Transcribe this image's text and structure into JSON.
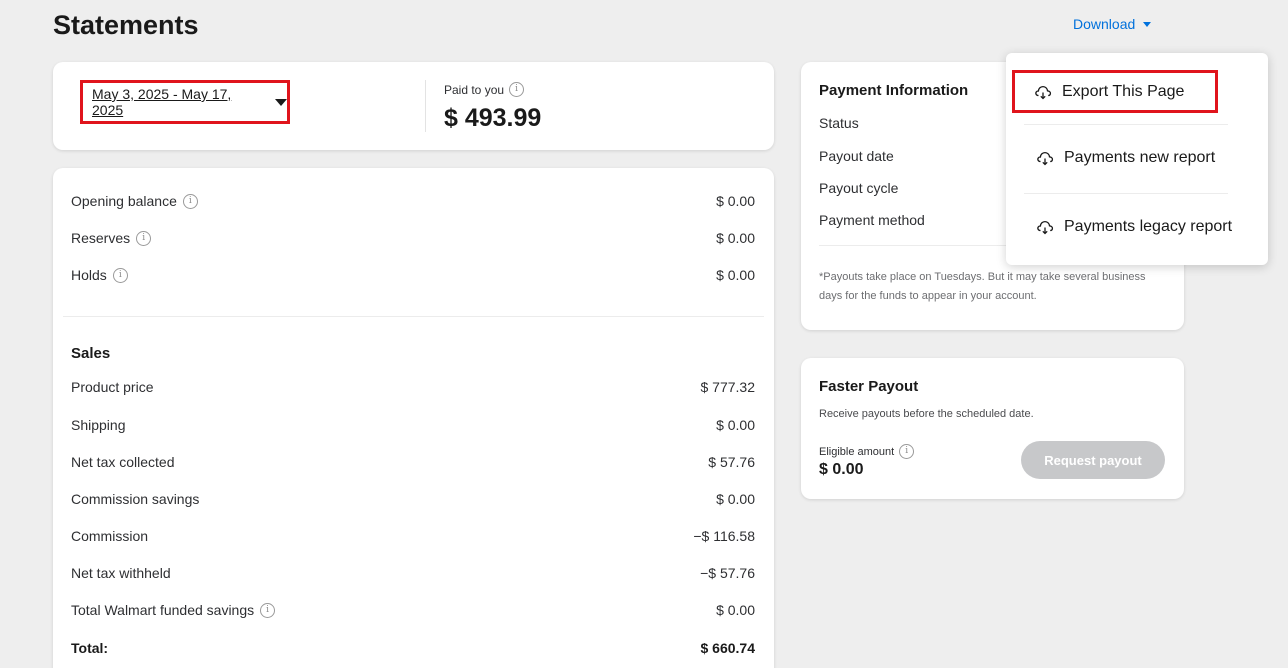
{
  "header": {
    "title": "Statements",
    "download_label": "Download"
  },
  "summary": {
    "date_range": "May 3, 2025 - May 17, 2025",
    "paid_label": "Paid to you",
    "paid_amount": "$ 493.99"
  },
  "balances": [
    {
      "label": "Opening balance",
      "value": "$ 0.00"
    },
    {
      "label": "Reserves",
      "value": "$ 0.00"
    },
    {
      "label": "Holds",
      "value": "$ 0.00"
    }
  ],
  "sales": {
    "heading": "Sales",
    "rows": [
      {
        "label": "Product price",
        "value": "$ 777.32"
      },
      {
        "label": "Shipping",
        "value": "$ 0.00"
      },
      {
        "label": "Net tax collected",
        "value": "$ 57.76"
      },
      {
        "label": "Commission savings",
        "value": "$ 0.00"
      },
      {
        "label": "Commission",
        "value": "−$ 116.58"
      },
      {
        "label": "Net tax withheld",
        "value": "−$ 57.76"
      },
      {
        "label": "Total Walmart funded savings",
        "value": "$ 0.00"
      }
    ],
    "total_label": "Total:",
    "total_value": "$ 660.74"
  },
  "payment_info": {
    "title": "Payment Information",
    "rows": [
      "Status",
      "Payout date",
      "Payout cycle",
      "Payment method"
    ],
    "note": "*Payouts take place on Tuesdays. But it may take several business days for the funds to appear in your account."
  },
  "faster_payout": {
    "title": "Faster Payout",
    "subtitle": "Receive payouts before the scheduled date.",
    "eligible_label": "Eligible amount",
    "eligible_amount": "$ 0.00",
    "button_label": "Request payout"
  },
  "download_menu": {
    "items": [
      "Export This Page",
      "Payments new report",
      "Payments legacy report"
    ]
  },
  "colors": {
    "accent": "#0071dc",
    "highlight_border": "#e0141c",
    "disabled_button": "#c7c8ca"
  },
  "icons": {
    "info": "info-icon",
    "cloud": "cloud-icon",
    "caret": "caret-down-icon"
  }
}
